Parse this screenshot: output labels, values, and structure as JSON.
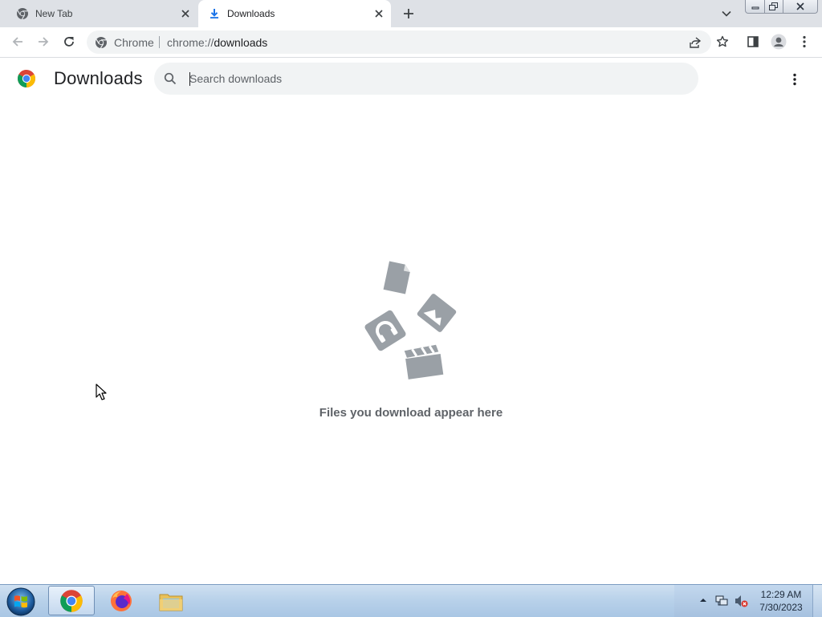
{
  "browser": {
    "tabs": [
      {
        "title": "New Tab",
        "favicon": "chrome-icon",
        "active": false
      },
      {
        "title": "Downloads",
        "favicon": "download-icon",
        "active": true
      }
    ],
    "omnibox": {
      "site_name": "Chrome",
      "url_scheme": "chrome://",
      "url_path": "downloads"
    }
  },
  "page": {
    "title": "Downloads",
    "search_placeholder": "Search downloads",
    "empty_message": "Files you download appear here"
  },
  "taskbar": {
    "apps": [
      "chrome",
      "firefox",
      "file-explorer"
    ],
    "clock": {
      "time": "12:29 AM",
      "date": "7/30/2023"
    }
  },
  "colors": {
    "tabstrip": "#dee1e6",
    "omnibox": "#f1f3f4",
    "illustration": "#9aa0a6",
    "empty_text": "#5f6368"
  }
}
